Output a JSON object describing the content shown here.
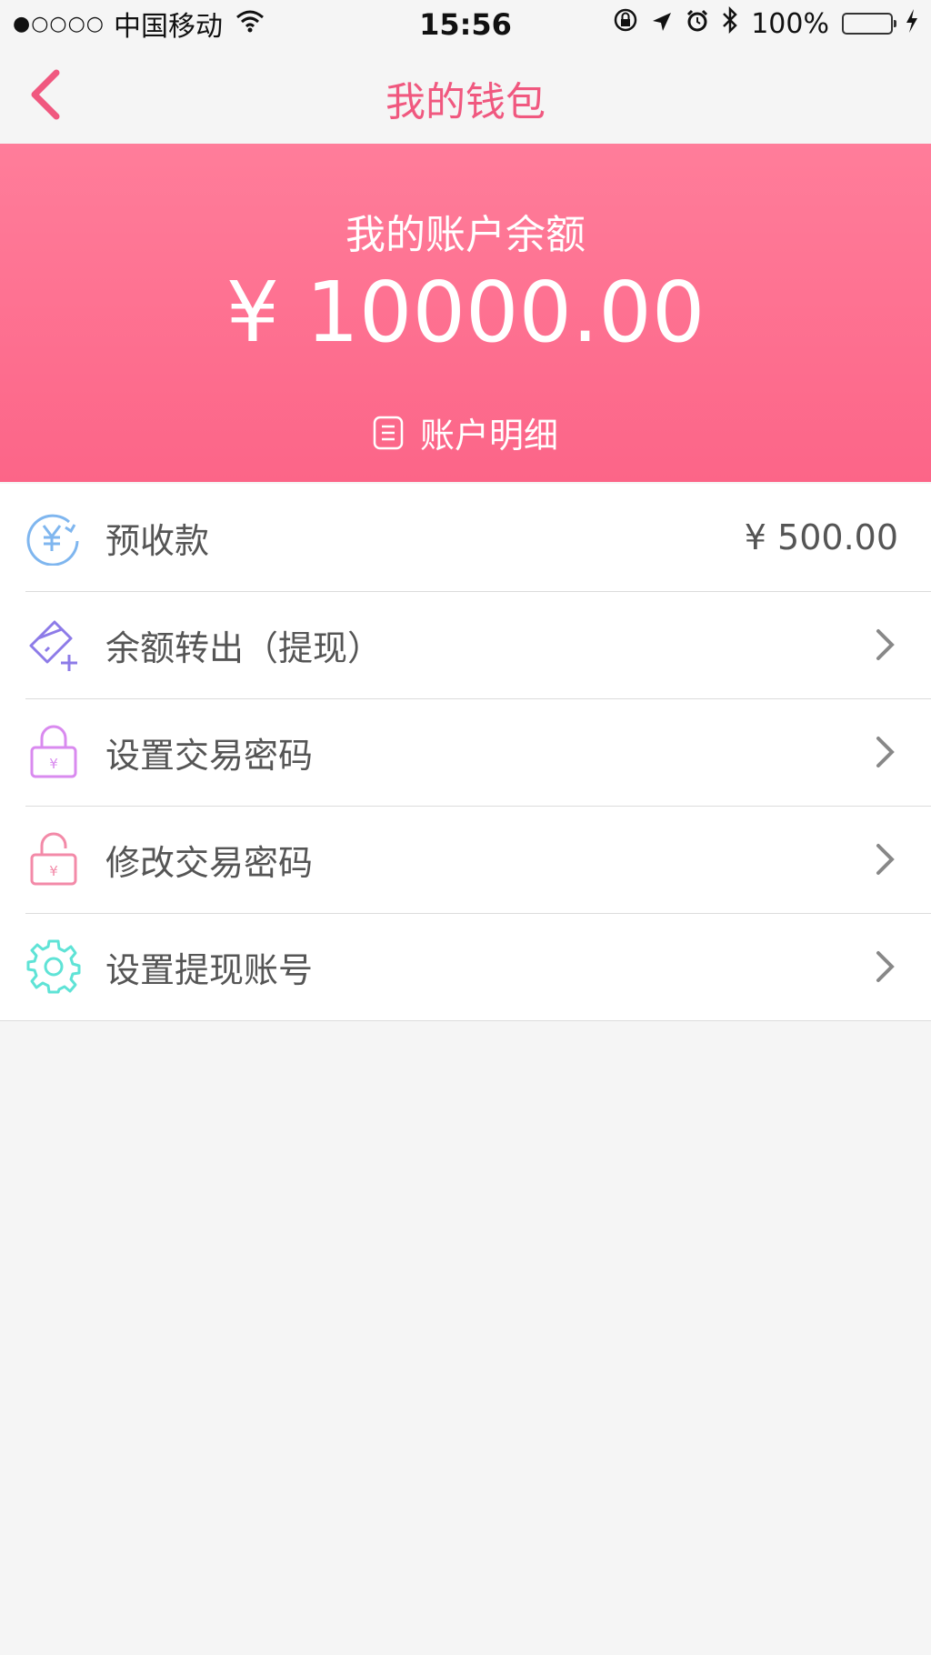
{
  "status_bar": {
    "signal": "●○○○○",
    "carrier": "中国移动",
    "time": "15:56",
    "battery": "100%"
  },
  "nav": {
    "title": "我的钱包",
    "accent_color": "#f0587f"
  },
  "wallet": {
    "balance_title": "我的账户余额",
    "balance_amount": "¥ 10000.00",
    "detail_label": "账户明细",
    "gradient": [
      "#ff7d9a",
      "#fc6588"
    ]
  },
  "menu": [
    {
      "label": "预收款",
      "value": "¥ 500.00",
      "icon": "yuan-refresh-icon",
      "icon_color": "#7fb6ef"
    },
    {
      "label": "余额转出（提现）",
      "icon": "card-plus-icon",
      "icon_color": "#8d7be8"
    },
    {
      "label": "设置交易密码",
      "icon": "lock-yuan-icon",
      "icon_color": "#d98aef"
    },
    {
      "label": "修改交易密码",
      "icon": "unlock-yuan-icon",
      "icon_color": "#f38aa8"
    },
    {
      "label": "设置提现账号",
      "icon": "gear-icon",
      "icon_color": "#5fe3d6"
    }
  ]
}
